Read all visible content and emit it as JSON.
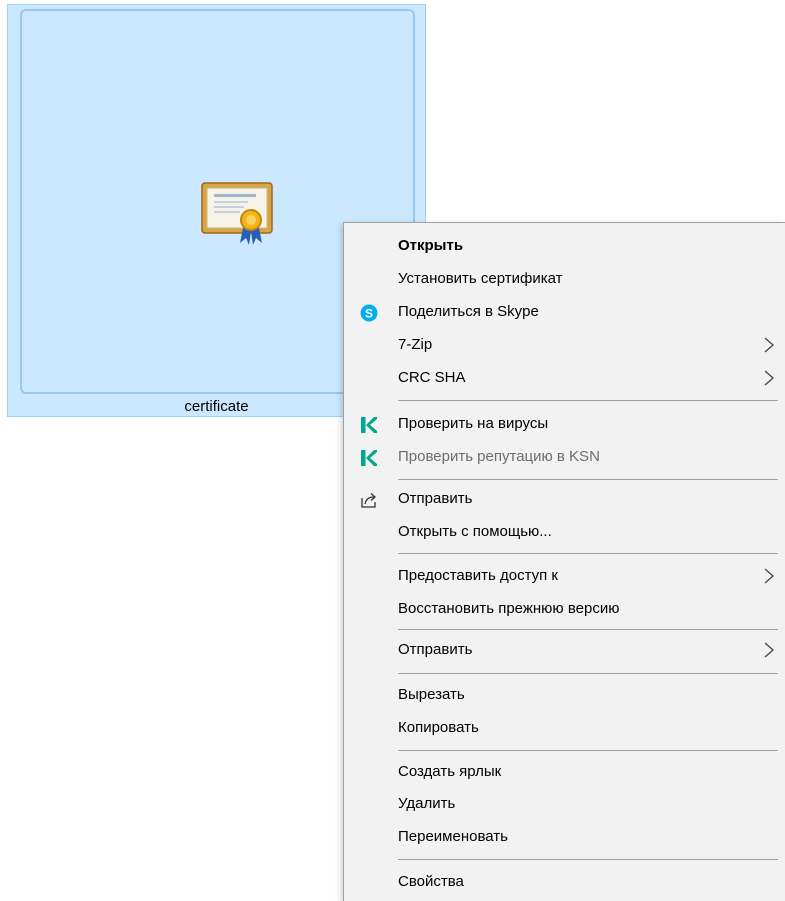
{
  "file": {
    "name": "certificate",
    "icon": "certificate-icon"
  },
  "menu": {
    "items": [
      {
        "label": "Открыть",
        "bold": true
      },
      {
        "label": "Установить сертификат"
      },
      {
        "label": "Поделиться в Skype",
        "icon": "skype-icon"
      },
      {
        "label": "7-Zip",
        "submenu": true
      },
      {
        "label": "CRC SHA",
        "submenu": true
      },
      {
        "label": "Проверить на вирусы",
        "icon": "kaspersky-icon"
      },
      {
        "label": "Проверить репутацию в KSN",
        "icon": "kaspersky-icon",
        "disabled": true
      },
      {
        "label": "Отправить",
        "icon": "share-icon"
      },
      {
        "label": "Открыть с помощью..."
      },
      {
        "label": "Предоставить доступ к",
        "submenu": true
      },
      {
        "label": "Восстановить прежнюю версию"
      },
      {
        "label": "Отправить",
        "submenu": true
      },
      {
        "label": "Вырезать"
      },
      {
        "label": "Копировать"
      },
      {
        "label": "Создать ярлык"
      },
      {
        "label": "Удалить"
      },
      {
        "label": "Переименовать"
      },
      {
        "label": "Свойства"
      }
    ]
  },
  "colors": {
    "selection": "#cce8ff",
    "menu_bg": "#f2f2f2",
    "skype": "#00aff0",
    "kaspersky": "#00a88e"
  }
}
